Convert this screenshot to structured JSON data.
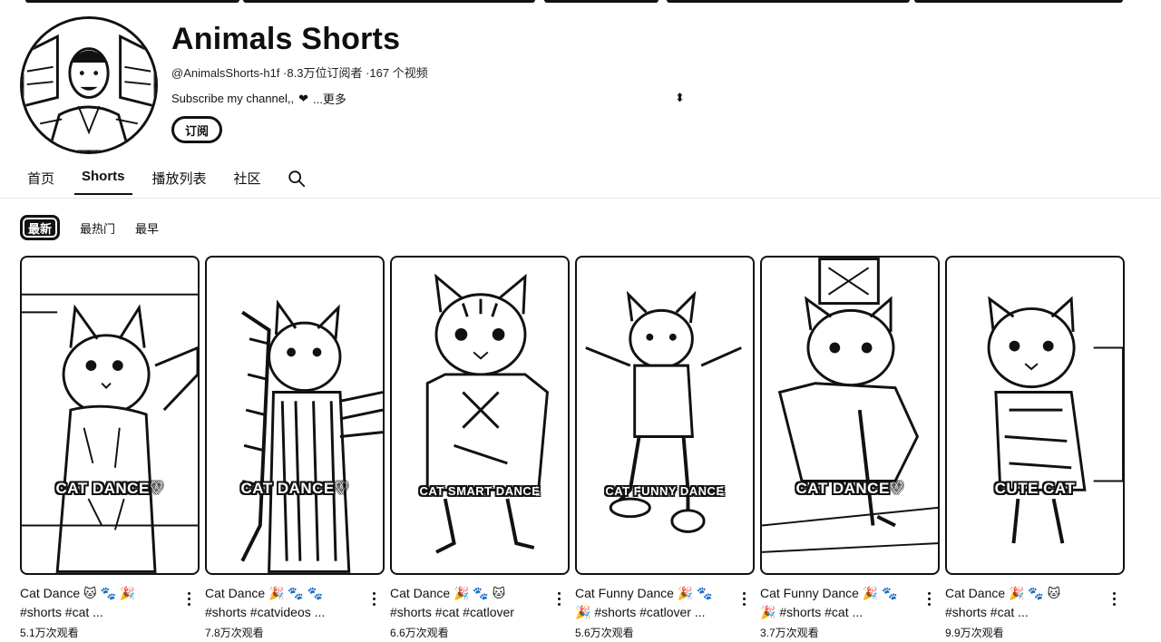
{
  "channel": {
    "name": "Animals Shorts",
    "handle": "@AnimalsShorts-h1f",
    "subscribers": "8.3万位订阅者",
    "video_count": "167 个视频",
    "description": "Subscribe my channel,,",
    "heart": "❤",
    "more_label": "...更多",
    "cursor_glyph": "⬍",
    "subscribe_label": "订阅"
  },
  "tabs": [
    {
      "label": "首页"
    },
    {
      "label": "Shorts",
      "active": true
    },
    {
      "label": "播放列表"
    },
    {
      "label": "社区"
    }
  ],
  "chips": [
    {
      "label": "最新",
      "active": true
    },
    {
      "label": "最热门"
    },
    {
      "label": "最早"
    }
  ],
  "videos": [
    {
      "overlay": "CAT DANCE♡",
      "title_line1": "Cat Dance 🐱 🐾 🎉",
      "title_line2": "#shorts #cat ...",
      "views": "5.1万次观看"
    },
    {
      "overlay": "CAT DANCE♡",
      "title_line1": "Cat Dance 🎉 🐾 🐾",
      "title_line2": "#shorts #catvideos ...",
      "views": "7.8万次观看"
    },
    {
      "overlay": "CAT SMART DANCE",
      "title_line1": "Cat Dance 🎉 🐾 🐱",
      "title_line2": "#shorts #cat #catlover",
      "views": "6.6万次观看"
    },
    {
      "overlay": "CAT FUNNY DANCE",
      "title_line1": "Cat Funny Dance 🎉 🐾",
      "title_line2": "🎉 #shorts #catlover ...",
      "views": "5.6万次观看"
    },
    {
      "overlay": "CAT DANCE♡",
      "title_line1": "Cat Funny Dance 🎉 🐾",
      "title_line2": "🎉 #shorts #cat ...",
      "views": "3.7万次观看"
    },
    {
      "overlay": "CUTE CAT",
      "title_line1": "Cat Dance 🎉 🐾 🐱",
      "title_line2": "#shorts #cat ...",
      "views": "9.9万次观看"
    }
  ]
}
